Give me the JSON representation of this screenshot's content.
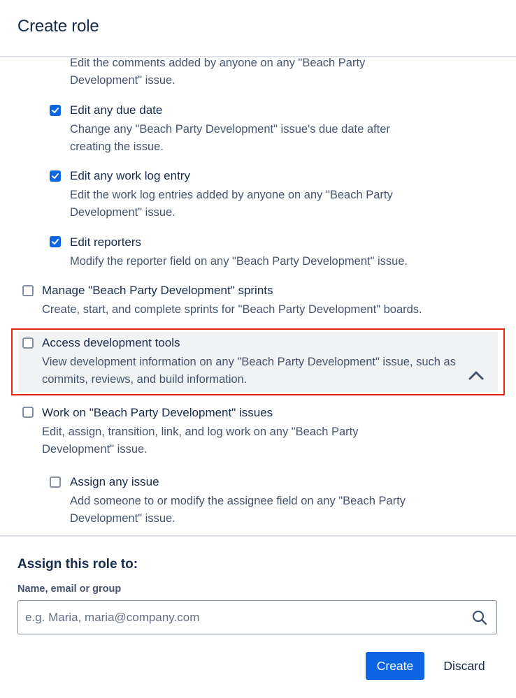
{
  "header": {
    "title": "Create role"
  },
  "permissions": {
    "edit_comments": {
      "desc": "Edit the comments added by anyone on any \"Beach Party Development\" issue."
    },
    "edit_due_date": {
      "title": "Edit any due date",
      "desc": "Change any \"Beach Party Development\" issue's due date after creating the issue.",
      "checked": true
    },
    "edit_work_log": {
      "title": "Edit any work log entry",
      "desc": "Edit the work log entries added by anyone on any \"Beach Party Development\" issue.",
      "checked": true
    },
    "edit_reporters": {
      "title": "Edit reporters",
      "desc": "Modify the reporter field on any \"Beach Party Development\" issue.",
      "checked": true
    },
    "manage_sprints": {
      "title": "Manage \"Beach Party Development\" sprints",
      "desc": "Create, start, and complete sprints for \"Beach Party Development\" boards.",
      "checked": false
    },
    "access_dev_tools": {
      "title": "Access development tools",
      "desc": "View development information on any \"Beach Party Development\" issue, such as commits, reviews, and build information.",
      "checked": false
    },
    "work_on_issues": {
      "title": "Work on \"Beach Party Development\" issues",
      "desc": "Edit, assign, transition, link, and log work on any \"Beach Party Development\" issue.",
      "checked": false
    },
    "assign_any_issue": {
      "title": "Assign any issue",
      "desc": "Add someone to or modify the assignee field on any \"Beach Party Development\" issue.",
      "checked": false
    }
  },
  "assign": {
    "title": "Assign this role to:",
    "field_label": "Name, email or group",
    "placeholder": "e.g. Maria, maria@company.com"
  },
  "actions": {
    "create_label": "Create",
    "discard_label": "Discard"
  },
  "colors": {
    "primary": "#0c66e4",
    "highlight_border": "#e3260f",
    "text": "#172b4d",
    "subtext": "#44546f"
  }
}
